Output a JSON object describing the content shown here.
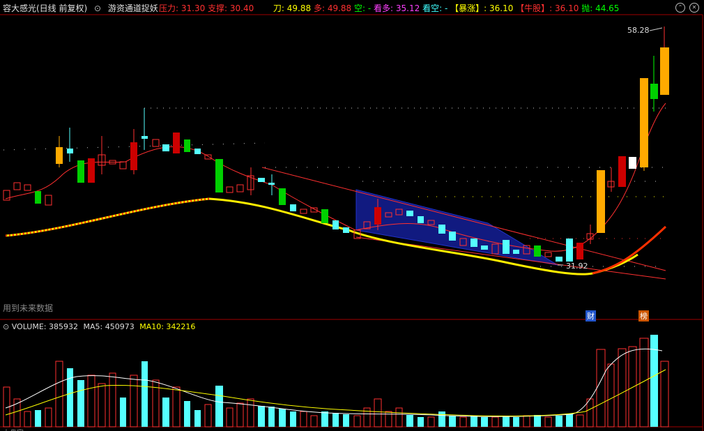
{
  "header": {
    "title": "容大感光(日线 前复权)",
    "indicator": "游资通道捉妖",
    "stats": [
      {
        "label": "压力: ",
        "value": "31.30",
        "color": "#ff3030"
      },
      {
        "label": "支撑: ",
        "value": "30.40",
        "color": "#ff3030"
      },
      {
        "label": "刀: ",
        "value": "49.88",
        "color": "#ffff00"
      },
      {
        "label": "多: ",
        "value": "49.88",
        "color": "#ff3030"
      },
      {
        "label": "空: ",
        "value": "-",
        "color": "#00ff00"
      },
      {
        "label": "看多: ",
        "value": "35.12",
        "color": "#ff40ff"
      },
      {
        "label": "看空: ",
        "value": "-",
        "color": "#40ffff"
      },
      {
        "label": "【暴涨】: ",
        "value": "36.10",
        "color": "#ffff00"
      },
      {
        "label": "【牛股】: ",
        "value": "36.10",
        "color": "#ff3030"
      },
      {
        "label": "抛: ",
        "value": "44.65",
        "color": "#00ff00"
      }
    ]
  },
  "main": {
    "future_data_note": "用到未来数据",
    "high_label": "58.28",
    "low_label": "31.92",
    "badges": [
      "财",
      "榜"
    ]
  },
  "volume": {
    "label": "VOLUME: 385932",
    "ma5": "MA5: 450973",
    "ma10": "MA10: 342216"
  },
  "footer": {
    "partial_text": "大盘定..."
  },
  "colors": {
    "up": "#ff3030",
    "down": "#00e000",
    "cyan": "#55ffff",
    "yellow": "#ffff00",
    "orange": "#ffaa00",
    "grid": "#a00000"
  }
}
